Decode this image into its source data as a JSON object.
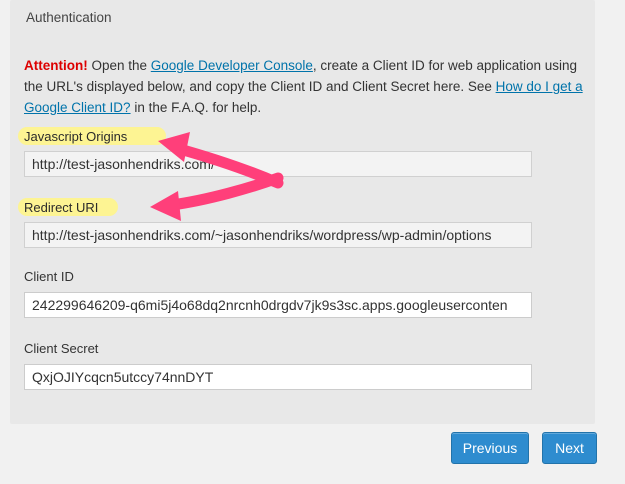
{
  "panel": {
    "title": "Authentication"
  },
  "notice": {
    "attention": "Attention!",
    "text_1": " Open the ",
    "link_console": "Google Developer Console",
    "text_2": ", create a Client ID for web application using the URL's displayed below, and copy the Client ID and Client Secret here. See ",
    "link_howto": "How do I get a Google Client ID?",
    "text_3": " in the F.A.Q. for help."
  },
  "fields": {
    "js_origins": {
      "label": "Javascript Origins",
      "value": "http://test-jasonhendriks.com/"
    },
    "redirect_uri": {
      "label": "Redirect URI",
      "value": "http://test-jasonhendriks.com/~jasonhendriks/wordpress/wp-admin/options"
    },
    "client_id": {
      "label": "Client ID",
      "value": "242299646209-q6mi5j4o68dq2nrcnh0drgdv7jk9s3sc.apps.googleuserconten"
    },
    "client_secret": {
      "label": "Client Secret",
      "value": "QxjOJIYcqcn5utccy74nnDYT"
    }
  },
  "buttons": {
    "previous": "Previous",
    "next": "Next"
  },
  "colors": {
    "attention": "#dd0000",
    "link": "#0073aa",
    "highlight": "#fff58a",
    "arrow": "#ff3f7a",
    "button": "#2e8ccf"
  }
}
